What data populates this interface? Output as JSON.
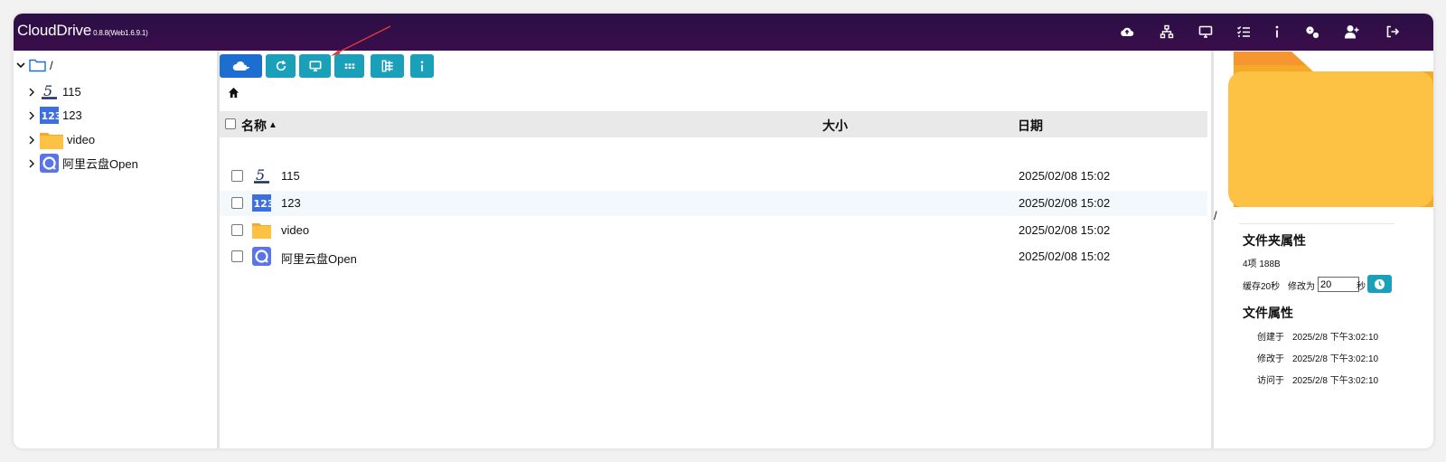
{
  "app": {
    "title": "CloudDrive",
    "version": "0.8.8(Web1.6.9.1)"
  },
  "topbar_icons": [
    "cloud-upload-icon",
    "network-icon",
    "desktop-icon",
    "task-list-icon",
    "info-icon",
    "settings-icon",
    "add-user-icon",
    "logout-icon"
  ],
  "tree": {
    "root_label": "/",
    "items": [
      {
        "label": "115",
        "icon": "115-logo-icon"
      },
      {
        "label": "123",
        "icon": "123-logo-icon"
      },
      {
        "label": "video",
        "icon": "folder-icon"
      },
      {
        "label": "阿里云盘Open",
        "icon": "aliyun-logo-icon"
      }
    ]
  },
  "toolbar": [
    "cloud-menu-button",
    "refresh-button",
    "desktop-button",
    "grid-view-button",
    "tree-view-button",
    "info-button"
  ],
  "table": {
    "headers": {
      "name": "名称",
      "size": "大小",
      "date": "日期"
    },
    "sort_indicator": "▲",
    "rows": [
      {
        "name": "115",
        "size": "",
        "date": "2025/02/08 15:02",
        "icon": "115-logo-icon"
      },
      {
        "name": "123",
        "size": "",
        "date": "2025/02/08 15:02",
        "icon": "123-logo-icon"
      },
      {
        "name": "video",
        "size": "",
        "date": "2025/02/08 15:02",
        "icon": "folder-icon"
      },
      {
        "name": "阿里云盘Open",
        "size": "",
        "date": "2025/02/08 15:02",
        "icon": "aliyun-logo-icon"
      }
    ]
  },
  "side": {
    "path": "/",
    "folder_props_title": "文件夹属性",
    "folder_summary": "4项  188B",
    "cache_label": "缓存20秒",
    "modify_label": "修改为",
    "cache_value": "20",
    "seconds_label": "秒",
    "file_props_title": "文件属性",
    "created_label": "创建于",
    "created_value": "2025/2/8 下午3:02:10",
    "modified_label": "修改于",
    "modified_value": "2025/2/8 下午3:02:10",
    "accessed_label": "访问于",
    "accessed_value": "2025/2/8 下午3:02:10"
  },
  "colors": {
    "topbar": "#2b0f45",
    "accent": "#1aa0b8",
    "primary": "#1c6fd1",
    "folder": "#fdc243"
  }
}
